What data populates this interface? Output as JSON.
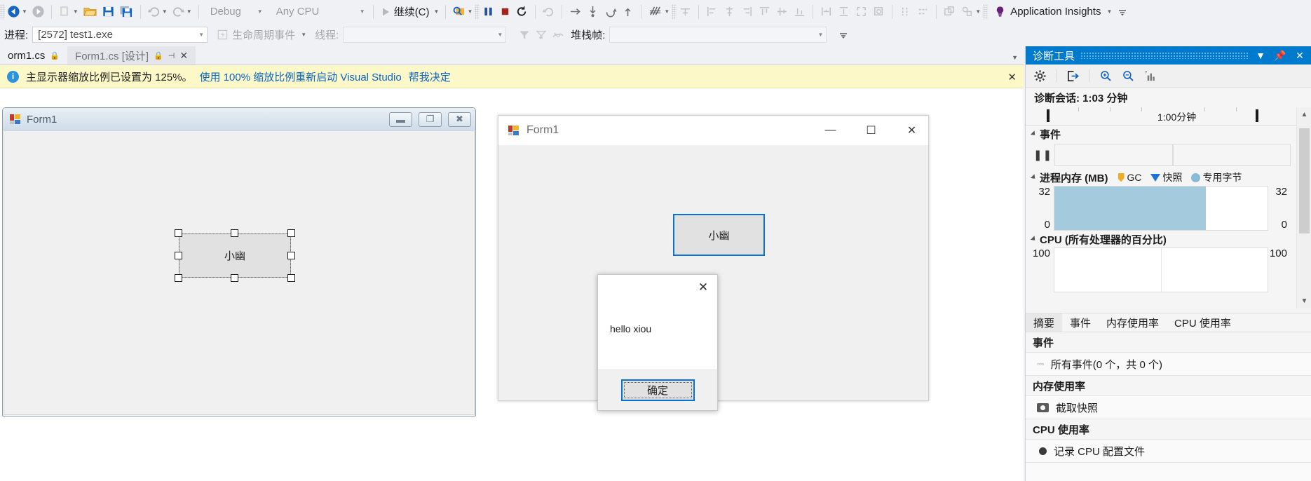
{
  "toolbar": {
    "nav_back_icon": "back-arrow-icon",
    "nav_forward_icon": "forward-arrow-icon",
    "new_item_icon": "new-item-icon",
    "open_file_icon": "open-file-icon",
    "save_icon": "save-icon",
    "save_all_icon": "save-all-icon",
    "undo_icon": "undo-icon",
    "redo_icon": "redo-icon",
    "config_value": "Debug",
    "platform_value": "Any CPU",
    "continue_label": "继续(C)",
    "continue_icon": "play-icon",
    "find_icon": "find-in-files-icon",
    "break_all_icon": "break-all-icon",
    "stop_icon": "stop-debugging-icon",
    "restart_icon": "restart-icon",
    "show_next_statement_icon": "show-next-statement-icon",
    "step_over_icon": "step-over-icon",
    "step_into_icon": "step-into-icon",
    "step_out_icon": "step-out-icon",
    "step_up_icon": "step-up-icon",
    "intellitrace_icon": "intellitrace-icon",
    "align_center_icon": "align-center-icon",
    "align_lefts_icon": "align-lefts-icon",
    "align_centers_icon": "align-centers-icon",
    "align_rights_icon": "align-rights-icon",
    "align_tops_icon": "align-tops-icon",
    "align_middles_icon": "align-middles-icon",
    "align_bottoms_icon": "align-bottoms-icon",
    "make_same_width_icon": "make-same-width-icon",
    "make_same_height_icon": "make-same-height-icon",
    "make_same_size_icon": "make-same-size-icon",
    "size_to_grid_icon": "size-to-grid-icon",
    "horiz_spacing_icon": "horizontal-spacing-icon",
    "vert_spacing_icon": "vertical-spacing-icon",
    "bring_to_front_icon": "bring-to-front-icon",
    "send_to_back_icon": "send-to-back-icon",
    "app_insights_label": "Application Insights",
    "app_insights_icon": "lightbulb-icon"
  },
  "debugbar": {
    "process_label": "进程:",
    "process_value": "[2572] test1.exe",
    "lifecycle_icon": "lifecycle-events-icon",
    "lifecycle_label": "生命周期事件",
    "thread_label": "线程:",
    "thread_value": "",
    "filter_icon": "filter-icon",
    "filter2_icon": "filter-dropdown-icon",
    "threads_icon": "threads-icon",
    "stackframe_label": "堆栈帧:",
    "stackframe_value": "",
    "overflow_icon": "toolbar-overflow-icon"
  },
  "tabs": {
    "items": [
      {
        "label": "orm1.cs",
        "pinned": true,
        "active": false,
        "closable": false
      },
      {
        "label": "Form1.cs [设计]",
        "pinned": true,
        "active": true,
        "closable": true
      }
    ],
    "overflow_icon": "tab-overflow-chevron-icon"
  },
  "infobar": {
    "icon": "info-icon",
    "text": "主显示器缩放比例已设置为 125%。",
    "link_restart": "使用 100% 缩放比例重新启动 Visual Studio",
    "link_help": "帮我决定",
    "close_label": "✕"
  },
  "design_form": {
    "title": "Form1",
    "icon": "winforms-app-icon",
    "minimize_label": "▬",
    "maximize_label": "❐",
    "close_label": "✖",
    "button_text": "小幽"
  },
  "run_form": {
    "title": "Form1",
    "icon": "winforms-app-icon",
    "minimize_label": "—",
    "maximize_label": "☐",
    "close_label": "✕",
    "button_text": "小幽"
  },
  "message_box": {
    "close_label": "✕",
    "text": "hello xiou",
    "ok_label": "确定"
  },
  "diagnostics": {
    "title": "诊断工具",
    "dropdown_icon": "chevron-down-icon",
    "pin_icon": "pin-icon",
    "close_icon": "close-icon",
    "toolbar": {
      "settings_icon": "gear-icon",
      "export_icon": "export-icon",
      "zoom_in_icon": "zoom-in-icon",
      "zoom_out_icon": "zoom-out-icon",
      "reset_view_icon": "reset-graph-view-icon"
    },
    "session_label": "诊断会话: 1:03 分钟",
    "ruler_label": "1:00分钟",
    "events": {
      "header": "事件",
      "pause_icon": "pause-icon"
    },
    "memory": {
      "header": "进程内存 (MB)",
      "legend_gc": "GC",
      "legend_snapshot": "快照",
      "legend_private_bytes": "专用字节",
      "axis_top_left": "32",
      "axis_top_right": "32",
      "axis_bottom_left": "0",
      "axis_bottom_right": "0"
    },
    "cpu": {
      "header": "CPU (所有处理器的百分比)",
      "axis_top_left": "100",
      "axis_top_right": "100"
    },
    "scroll_up_icon": "scroll-up-icon",
    "scroll_down_icon": "scroll-down-icon",
    "tabs": [
      {
        "label": "摘要",
        "selected": true
      },
      {
        "label": "事件",
        "selected": false
      },
      {
        "label": "内存使用率",
        "selected": false
      },
      {
        "label": "CPU 使用率",
        "selected": false
      }
    ],
    "summary": {
      "events_header": "事件",
      "events_item": "所有事件(0 个，共 0 个)",
      "events_item_icon": "events-icon",
      "memory_header": "内存使用率",
      "memory_item": "截取快照",
      "memory_item_icon": "camera-icon",
      "cpu_header": "CPU 使用率",
      "cpu_item": "记录 CPU 配置文件",
      "cpu_item_icon": "record-icon"
    }
  },
  "colors": {
    "accent_blue": "#007acc",
    "link_blue": "#0a64c8",
    "info_yellow": "#fcf8c8",
    "memory_fill": "#a4cbdd",
    "shell_bg": "#eff1f5"
  },
  "chart_data": [
    {
      "type": "area",
      "title": "进程内存 (MB)",
      "ylabel": "MB",
      "ylim": [
        0,
        32
      ],
      "x": [
        0,
        1,
        2,
        3,
        4,
        5,
        6,
        7
      ],
      "values": [
        32,
        32,
        32,
        32,
        32,
        32,
        0,
        0
      ],
      "legend": [
        "GC",
        "快照",
        "专用字节"
      ],
      "legend_position": "header-right",
      "grid": false,
      "axis_labels_left": [
        "32",
        "0"
      ],
      "axis_labels_right": [
        "32",
        "0"
      ]
    },
    {
      "type": "area",
      "title": "CPU (所有处理器的百分比)",
      "ylabel": "%",
      "ylim": [
        0,
        100
      ],
      "x": [
        0,
        1,
        2,
        3,
        4,
        5,
        6,
        7
      ],
      "values": [
        0,
        0,
        0,
        0,
        0,
        0,
        0,
        0
      ],
      "grid": false,
      "axis_labels_left": [
        "100"
      ],
      "axis_labels_right": [
        "100"
      ]
    }
  ]
}
